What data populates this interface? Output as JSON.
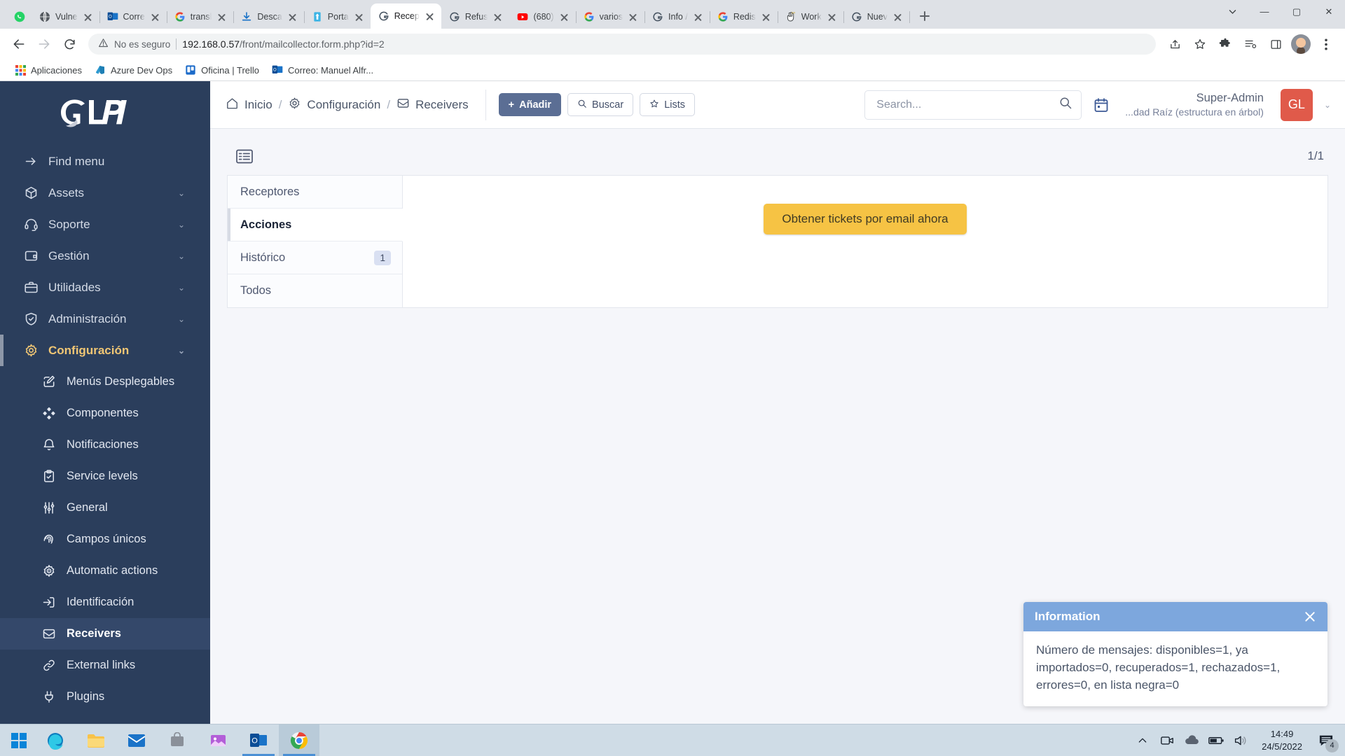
{
  "browser": {
    "tabs": [
      {
        "title": "",
        "icon": "whatsapp-icon",
        "active": false,
        "nosep": true
      },
      {
        "title": "Vulne",
        "icon": "globe-dark-icon",
        "active": false
      },
      {
        "title": "Corre",
        "icon": "outlook-icon",
        "active": false
      },
      {
        "title": "transl",
        "icon": "google-icon",
        "active": false
      },
      {
        "title": "Desca",
        "icon": "download-icon",
        "active": false
      },
      {
        "title": "Porta",
        "icon": "portal-icon",
        "active": false
      },
      {
        "title": "Recep",
        "icon": "glpi-icon",
        "active": true
      },
      {
        "title": "Refus",
        "icon": "glpi-icon",
        "active": false
      },
      {
        "title": "(680)",
        "icon": "youtube-icon",
        "active": false
      },
      {
        "title": "varios",
        "icon": "google-icon",
        "active": false
      },
      {
        "title": "Info /",
        "icon": "glpi-icon",
        "active": false
      },
      {
        "title": "Redis",
        "icon": "google-icon",
        "active": false
      },
      {
        "title": "Work",
        "icon": "hand-icon",
        "active": false
      },
      {
        "title": "Nuev",
        "icon": "glpi-icon",
        "active": false
      }
    ],
    "new_tab_label": "+",
    "window_controls": {
      "minimize": "—",
      "maximize": "▢",
      "close": "✕"
    },
    "omnibox": {
      "security_label": "No es seguro",
      "url_host": "192.168.0.57",
      "url_path": "/front/mailcollector.form.php?id=2",
      "warning_icon": "warning-triangle-icon"
    },
    "bookmarks": [
      {
        "label": "Aplicaciones",
        "icon": "apps-grid-icon"
      },
      {
        "label": "Azure Dev Ops",
        "icon": "azure-icon"
      },
      {
        "label": "Oficina | Trello",
        "icon": "trello-icon"
      },
      {
        "label": "Correo: Manuel Alfr...",
        "icon": "outlook-icon"
      }
    ]
  },
  "sidebar": {
    "logo_text": "GLPI",
    "items": [
      {
        "label": "Find menu",
        "icon": "arrow-right-icon",
        "expandable": false,
        "active": false
      },
      {
        "label": "Assets",
        "icon": "box-icon",
        "expandable": true,
        "active": false
      },
      {
        "label": "Soporte",
        "icon": "headset-icon",
        "expandable": true,
        "active": false
      },
      {
        "label": "Gestión",
        "icon": "wallet-icon",
        "expandable": true,
        "active": false
      },
      {
        "label": "Utilidades",
        "icon": "briefcase-icon",
        "expandable": true,
        "active": false
      },
      {
        "label": "Administración",
        "icon": "shield-check-icon",
        "expandable": true,
        "active": false
      },
      {
        "label": "Configuración",
        "icon": "gear-icon",
        "expandable": true,
        "active": true
      }
    ],
    "subitems": [
      {
        "label": "Menús Desplegables",
        "icon": "edit-square-icon",
        "active": false
      },
      {
        "label": "Componentes",
        "icon": "components-icon",
        "active": false
      },
      {
        "label": "Notificaciones",
        "icon": "bell-icon",
        "active": false
      },
      {
        "label": "Service levels",
        "icon": "clipboard-check-icon",
        "active": false
      },
      {
        "label": "General",
        "icon": "sliders-icon",
        "active": false
      },
      {
        "label": "Campos únicos",
        "icon": "fingerprint-icon",
        "active": false
      },
      {
        "label": "Automatic actions",
        "icon": "gear-play-icon",
        "active": false
      },
      {
        "label": "Identificación",
        "icon": "login-icon",
        "active": false
      },
      {
        "label": "Receivers",
        "icon": "inbox-icon",
        "active": true
      },
      {
        "label": "External links",
        "icon": "link-icon",
        "active": false
      },
      {
        "label": "Plugins",
        "icon": "plug-icon",
        "active": false
      }
    ]
  },
  "topbar": {
    "breadcrumb": [
      {
        "label": "Inicio",
        "icon": "home-icon"
      },
      {
        "label": "Configuración",
        "icon": "gear-icon"
      },
      {
        "label": "Receivers",
        "icon": "inbox-icon"
      }
    ],
    "separator": "/",
    "buttons": [
      {
        "label": "Añadir",
        "icon": "plus-icon",
        "style": "primary"
      },
      {
        "label": "Buscar",
        "icon": "search-icon",
        "style": "default"
      },
      {
        "label": "Lists",
        "icon": "star-icon",
        "style": "default"
      }
    ],
    "search_placeholder": "Search...",
    "search_value": "",
    "calendar_icon": "calendar-icon",
    "user_name": "Super-Admin",
    "user_entity": "...dad Raíz (estructura en árbol)",
    "user_initials": "GL",
    "user_avatar_color": "#e05a4a"
  },
  "content": {
    "list_icon": "list-view-icon",
    "pager": "1/1",
    "tabs": [
      {
        "label": "Receptores",
        "badge": "",
        "active": false
      },
      {
        "label": "Acciones",
        "badge": "",
        "active": true
      },
      {
        "label": "Histórico",
        "badge": "1",
        "active": false
      },
      {
        "label": "Todos",
        "badge": "",
        "active": false
      }
    ],
    "action_button": "Obtener tickets por email ahora"
  },
  "toast": {
    "title": "Information",
    "message": "Número de mensajes: disponibles=1, ya importados=0, recuperados=1, rechazados=1, errores=0, en lista negra=0",
    "header_color": "#7da7dd"
  },
  "taskbar": {
    "start_icon": "windows-start-icon",
    "apps": [
      {
        "name": "edge-icon",
        "open": false
      },
      {
        "name": "file-explorer-icon",
        "open": false
      },
      {
        "name": "mail-icon",
        "open": false
      },
      {
        "name": "store-icon",
        "open": false
      },
      {
        "name": "photos-icon",
        "open": false
      },
      {
        "name": "outlook-icon",
        "open": true
      },
      {
        "name": "chrome-icon",
        "open": true,
        "active": true
      }
    ],
    "tray": [
      {
        "name": "chevron-up-icon"
      },
      {
        "name": "camera-icon"
      },
      {
        "name": "onedrive-icon"
      },
      {
        "name": "battery-icon"
      },
      {
        "name": "volume-icon"
      }
    ],
    "time": "14:49",
    "date": "24/5/2022",
    "notification_count": "4",
    "notification_icon": "notification-icon"
  }
}
